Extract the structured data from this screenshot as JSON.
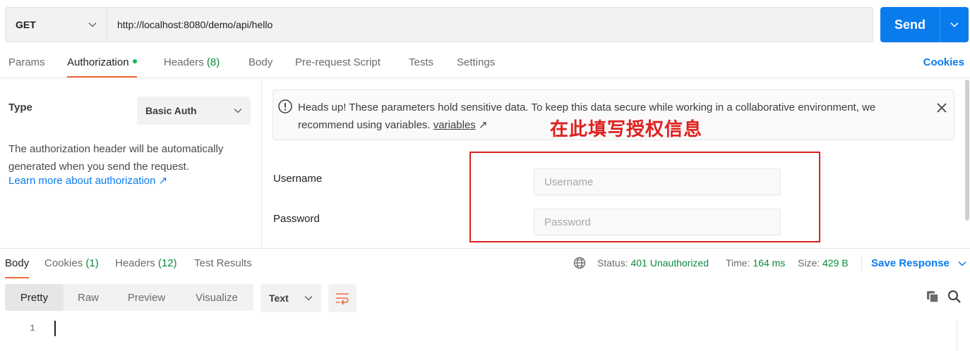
{
  "request": {
    "method": "GET",
    "url": "http://localhost:8080/demo/api/hello",
    "send_label": "Send"
  },
  "tabs": {
    "params": "Params",
    "authorization": "Authorization",
    "headers": "Headers",
    "headers_count": "(8)",
    "body": "Body",
    "prerequest": "Pre-request Script",
    "tests": "Tests",
    "settings": "Settings",
    "cookies": "Cookies"
  },
  "auth": {
    "type_label": "Type",
    "type_value": "Basic Auth",
    "description": "The authorization header will be automatically generated when you send the request.",
    "learn_more": "Learn more about authorization ↗",
    "notice_text": "Heads up! These parameters hold sensitive data. To keep this data secure while working in a collaborative environment, we recommend using variables.",
    "notice_link": "variables",
    "notice_link_arrow": "↗",
    "annotation": "在此填写授权信息",
    "username_label": "Username",
    "username_placeholder": "Username",
    "password_label": "Password",
    "password_placeholder": "Password"
  },
  "response": {
    "tabs": {
      "body": "Body",
      "cookies": "Cookies",
      "cookies_count": "(1)",
      "headers": "Headers",
      "headers_count": "(12)",
      "test_results": "Test Results"
    },
    "status_label": "Status:",
    "status_value": "401 Unauthorized",
    "time_label": "Time:",
    "time_value": "164 ms",
    "size_label": "Size:",
    "size_value": "429 B",
    "save_label": "Save Response",
    "views": [
      "Pretty",
      "Raw",
      "Preview",
      "Visualize"
    ],
    "format": "Text",
    "line_number": "1"
  },
  "colors": {
    "accent": "#097bed",
    "tab_underline": "#f26b3a",
    "status_green": "#0a8a3c",
    "annotation_red": "#e0201f"
  }
}
